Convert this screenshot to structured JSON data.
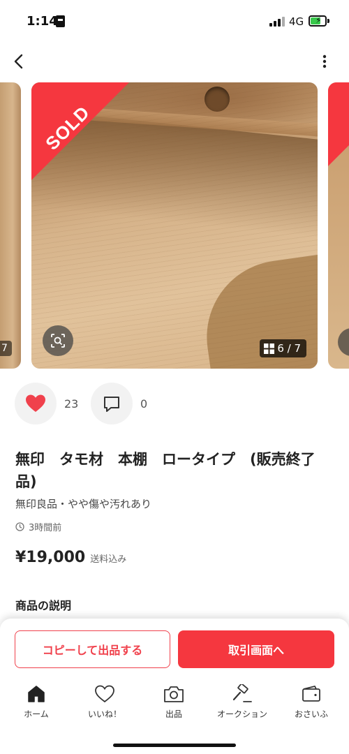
{
  "status_bar": {
    "time": "1:14",
    "network": "4G",
    "battery_icon": "battery-charging-icon"
  },
  "nav": {
    "back_icon": "chevron-left-icon",
    "more_icon": "more-vertical-icon"
  },
  "gallery": {
    "sold_label": "SOLD",
    "counter": "6 / 7",
    "prev_counter": "7",
    "accent": "#f5373f"
  },
  "actions": {
    "like_count": "23",
    "comment_count": "0",
    "like_color": "#f0414c"
  },
  "item": {
    "title": "無印　タモ材　本棚　ロータイプ　(販売終了品)",
    "subtitle": "無印良品・やや傷や汚れあり",
    "posted": "3時間前",
    "price": "¥19,000",
    "shipping": "送料込み",
    "description_heading": "商品の説明"
  },
  "buttons": {
    "copy_listing": "コピーして出品する",
    "trade_screen": "取引画面へ"
  },
  "tabs": [
    {
      "label": "ホーム",
      "icon": "home-icon"
    },
    {
      "label": "いいね！",
      "icon": "heart-icon"
    },
    {
      "label": "出品",
      "icon": "camera-icon"
    },
    {
      "label": "オークション",
      "icon": "gavel-icon"
    },
    {
      "label": "おさいふ",
      "icon": "wallet-icon"
    }
  ]
}
